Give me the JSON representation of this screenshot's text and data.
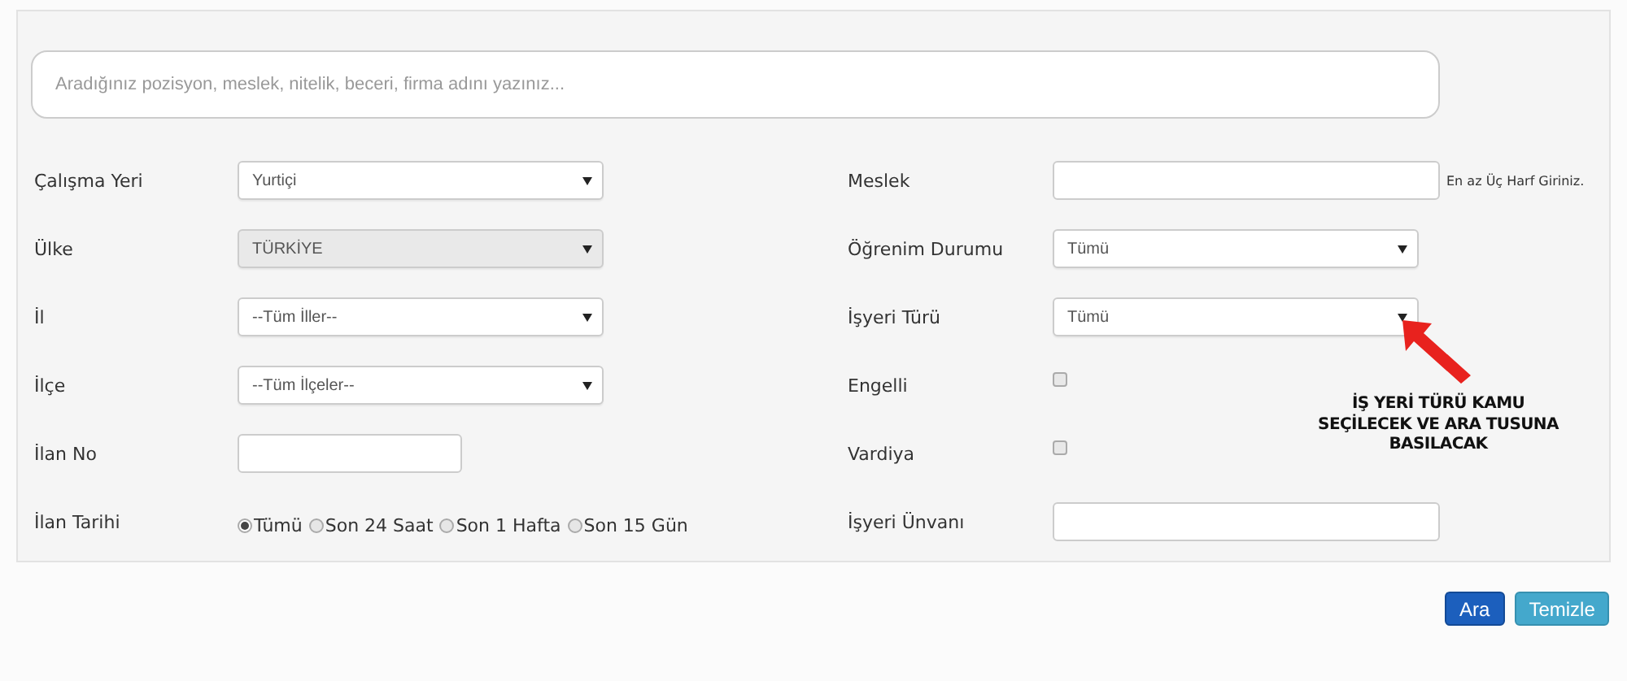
{
  "search": {
    "placeholder": "Aradığınız pozisyon, meslek, nitelik, beceri, firma adını yazınız..."
  },
  "left_fields": [
    {
      "label": "Çalışma Yeri",
      "kind": "select",
      "value": "Yurtiçi",
      "disabled": false
    },
    {
      "label": "Ülke",
      "kind": "select",
      "value": "TÜRKİYE",
      "disabled": true
    },
    {
      "label": "İl",
      "kind": "select",
      "value": "--Tüm İller--",
      "disabled": false
    },
    {
      "label": "İlçe",
      "kind": "select",
      "value": "--Tüm İlçeler--",
      "disabled": false
    },
    {
      "label": "İlan No",
      "kind": "input"
    },
    {
      "label": "İlan Tarihi",
      "kind": "radio",
      "options": [
        {
          "label": "Tümü",
          "selected": true
        },
        {
          "label": "Son 24 Saat",
          "selected": false
        },
        {
          "label": "Son 1 Hafta",
          "selected": false
        },
        {
          "label": "Son 15 Gün",
          "selected": false
        }
      ]
    }
  ],
  "right_fields": [
    {
      "label": "Meslek",
      "kind": "input",
      "note": "En az Üç Harf Giriniz."
    },
    {
      "label": "Öğrenim Durumu",
      "kind": "select",
      "value": "Tümü",
      "disabled": false
    },
    {
      "label": "İşyeri Türü",
      "kind": "select",
      "value": "Tümü",
      "disabled": false
    },
    {
      "label": "Engelli",
      "kind": "checkbox",
      "checked": false
    },
    {
      "label": "Vardiya",
      "kind": "checkbox",
      "checked": false
    },
    {
      "label": "İşyeri Ünvanı",
      "kind": "input"
    }
  ],
  "annotation": {
    "text": "İŞ YERİ TÜRÜ KAMU SEÇİLECEK VE ARA TUSUNA BASILACAK"
  },
  "buttons": [
    {
      "label": "Ara",
      "kind": "primary"
    },
    {
      "label": "Temizle",
      "kind": "info"
    }
  ]
}
